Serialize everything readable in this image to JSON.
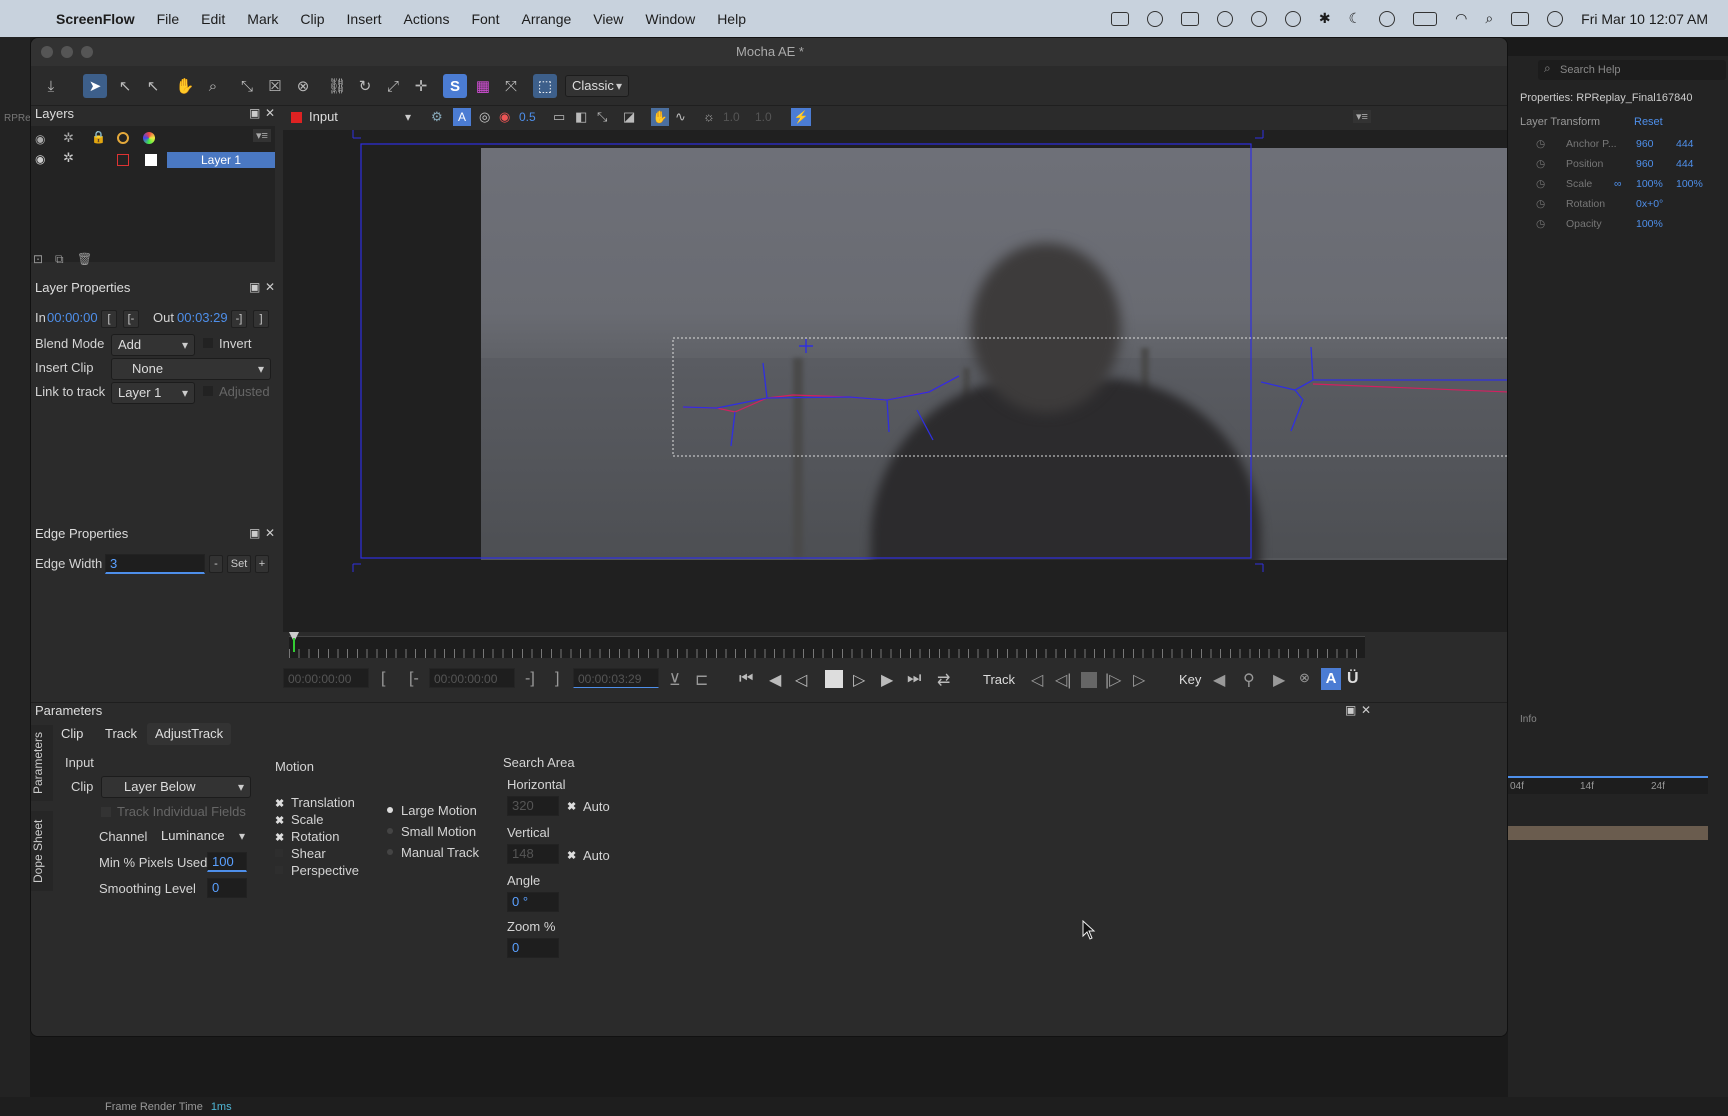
{
  "menubar": {
    "app": "ScreenFlow",
    "items": [
      "File",
      "Edit",
      "Mark",
      "Clip",
      "Insert",
      "Actions",
      "Font",
      "Arrange",
      "View",
      "Window",
      "Help"
    ],
    "clock": "Fri Mar 10  12:07 AM"
  },
  "window": {
    "title": "Mocha AE *"
  },
  "toolbar": {
    "view_mode": "Classic"
  },
  "layers_panel": {
    "title": "Layers",
    "layer_name": "Layer 1"
  },
  "viewer_bar": {
    "input": "Input",
    "opacity_value": "0.5",
    "gamma_a": "1.0",
    "gamma_b": "1.0"
  },
  "layer_properties": {
    "title": "Layer Properties",
    "in_label": "In",
    "in_value": "00:00:00",
    "out_label": "Out",
    "out_value": "00:03:29",
    "blend_mode_label": "Blend Mode",
    "blend_mode_value": "Add",
    "invert_label": "Invert",
    "insert_clip_label": "Insert Clip",
    "insert_clip_value": "None",
    "link_to_track_label": "Link to track",
    "link_to_track_value": "Layer 1",
    "adjusted_label": "Adjusted"
  },
  "edge_properties": {
    "title": "Edge Properties",
    "edge_width_label": "Edge Width",
    "edge_width_value": "3",
    "minus": "-",
    "set": "Set",
    "plus": "+"
  },
  "timeline": {
    "start_time": "00:00:00:00",
    "in_time": "00:00:00:00",
    "out_time": "00:00:03:29",
    "track_label": "Track",
    "key_label": "Key"
  },
  "parameters": {
    "title": "Parameters",
    "tabs": [
      "Clip",
      "Track",
      "AdjustTrack"
    ],
    "side_tabs": [
      "Parameters",
      "Dope Sheet"
    ],
    "input_heading": "Input",
    "clip_label": "Clip",
    "clip_value": "Layer Below",
    "track_individual_fields": "Track Individual Fields",
    "channel_label": "Channel",
    "channel_value": "Luminance",
    "min_pixels_label": "Min % Pixels Used",
    "min_pixels_value": "100",
    "smoothing_label": "Smoothing Level",
    "smoothing_value": "0",
    "motion_heading": "Motion",
    "motion_options": [
      "Translation",
      "Scale",
      "Rotation",
      "Shear",
      "Perspective"
    ],
    "motion_modes": [
      "Large Motion",
      "Small Motion",
      "Manual Track"
    ],
    "search_area_heading": "Search Area",
    "horizontal_label": "Horizontal",
    "horizontal_value": "320",
    "vertical_label": "Vertical",
    "vertical_value": "148",
    "auto_label": "Auto",
    "angle_label": "Angle",
    "angle_value": "0 °",
    "zoom_label": "Zoom %",
    "zoom_value": "0"
  },
  "ae_right": {
    "search_placeholder": "Search Help",
    "properties_title": "Properties: RPReplay_Final167840",
    "layer_transform": "Layer Transform",
    "reset": "Reset",
    "rows": [
      {
        "name": "Anchor P...",
        "v1": "960",
        "v2": "444"
      },
      {
        "name": "Position",
        "v1": "960",
        "v2": "444"
      },
      {
        "name": "Scale",
        "v1": "100%",
        "v2": "100%"
      },
      {
        "name": "Rotation",
        "v1": "0x+0°",
        "v2": ""
      },
      {
        "name": "Opacity",
        "v1": "100%",
        "v2": ""
      }
    ],
    "info": "Info",
    "ruler_labels": [
      "04f",
      "14f",
      "24f"
    ]
  },
  "ae_left": {
    "label": "RPRe"
  },
  "status": {
    "frame_render_label": "Frame Render Time",
    "frame_render_value": "1ms"
  },
  "colors": {
    "accent": "#4e8fea",
    "layer_select": "#4a78c2",
    "spline": "#2f2fe0"
  }
}
